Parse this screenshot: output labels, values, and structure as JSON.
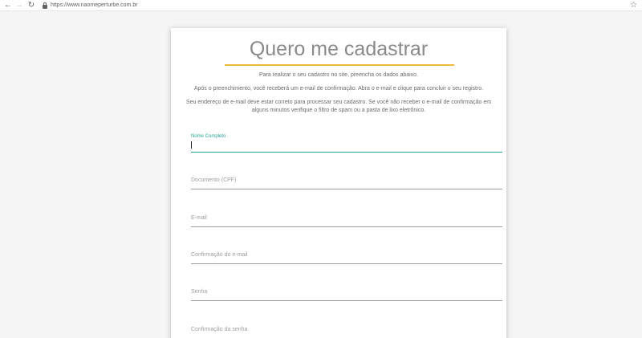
{
  "browser": {
    "url": "https://www.naomeperturbe.com.br",
    "back_glyph": "←",
    "forward_glyph": "→",
    "reload_glyph": "↻",
    "star_glyph": "☆"
  },
  "form": {
    "title": "Quero me cadastrar",
    "accent_color": "#f0b93a",
    "active_color": "#26a69a",
    "intro": [
      "Para realizar o seu cadastro no site, preencha os dados abaixo.",
      "Após o preenchimento, você receberá um e-mail de confirmação. Abra o e-mail e clique para concluir o seu registro.",
      "Seu endereço de e-mail deve estar correto para processar seu cadastro. Se você não receber o e-mail de confirmação em alguns minutos verifique o filtro de spam ou a pasta de lixo eletrônico."
    ],
    "fields": [
      {
        "label": "Nome Completo",
        "value": ""
      },
      {
        "label": "Documento (CPF)",
        "value": ""
      },
      {
        "label": "E-mail",
        "value": ""
      },
      {
        "label": "Confirmação do e-mail",
        "value": ""
      },
      {
        "label": "Senha",
        "value": ""
      },
      {
        "label": "Confirmação da senha",
        "value": ""
      }
    ]
  }
}
